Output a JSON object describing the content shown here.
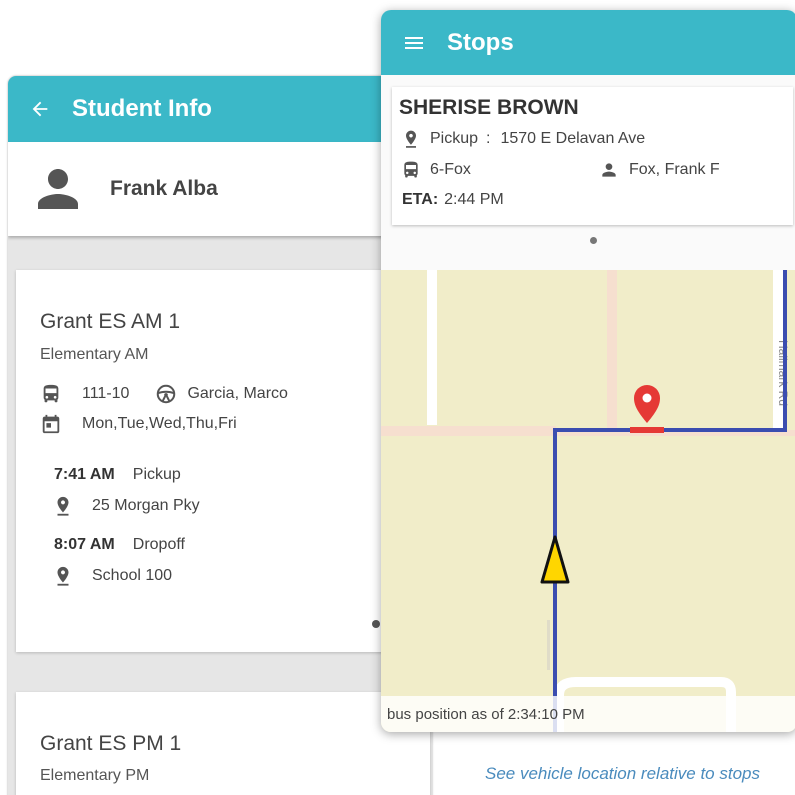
{
  "student_info": {
    "title": "Student Info",
    "student_name": "Frank Alba",
    "routes": [
      {
        "name": "Grant ES AM 1",
        "type": "Elementary AM",
        "bus": "111-10",
        "driver": "Garcia, Marco",
        "days": "Mon,Tue,Wed,Thu,Fri",
        "events": [
          {
            "time": "7:41 AM",
            "label": "Pickup",
            "location": "25 Morgan Pky"
          },
          {
            "time": "8:07 AM",
            "label": "Dropoff",
            "location": "School 100"
          }
        ]
      },
      {
        "name": "Grant ES PM 1",
        "type": "Elementary PM"
      }
    ]
  },
  "stops": {
    "title": "Stops",
    "student_name": "SHERISE BROWN",
    "pickup_label": "Pickup",
    "pickup_separator": ":",
    "pickup_address": "1570 E Delavan Ave",
    "bus": "6-Fox",
    "driver": "Fox, Frank F",
    "eta_label": "ETA:",
    "eta_time": "2:44 PM",
    "map_footer": "bus position as of 2:34:10 PM"
  },
  "caption": "See vehicle location relative to stops",
  "colors": {
    "header": "#3bb8c8",
    "route_line": "#3b4db0",
    "stop_marker": "#e53935",
    "bus_marker": "#ffd600",
    "map_background": "#f1edc9",
    "caption": "#4a8bbd"
  },
  "icons": {
    "back": "arrow-left-icon",
    "avatar": "person-icon",
    "bus": "bus-icon",
    "driver": "steering-wheel-icon",
    "calendar": "calendar-icon",
    "location": "map-pin-icon",
    "menu": "hamburger-menu-icon"
  }
}
